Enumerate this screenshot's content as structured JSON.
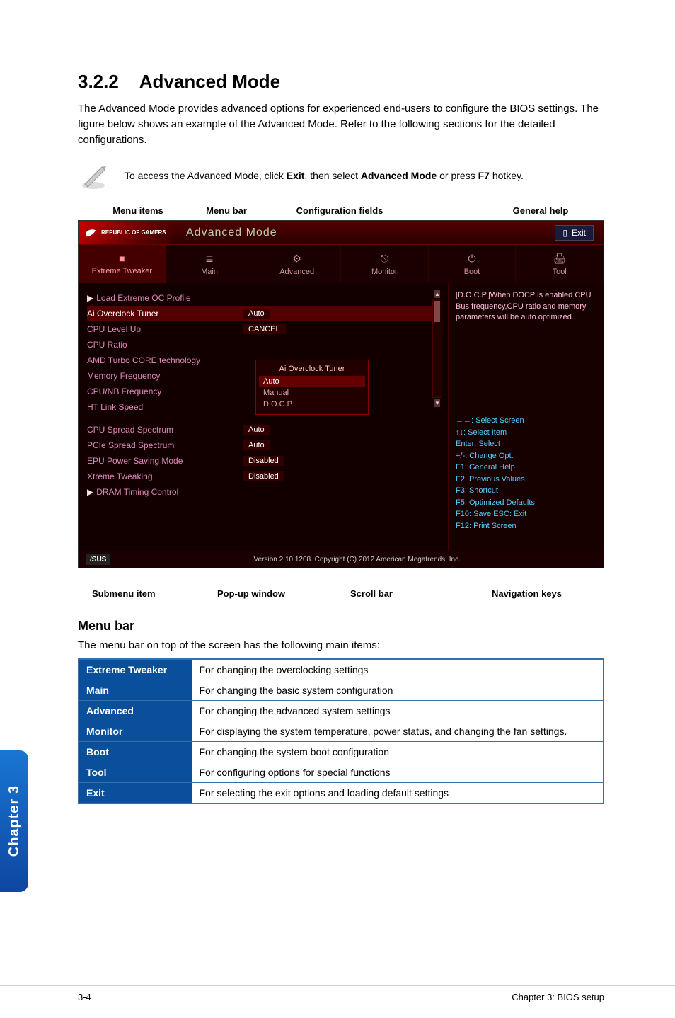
{
  "section": {
    "number": "3.2.2",
    "title": "Advanced Mode"
  },
  "intro": "The Advanced Mode provides advanced options for experienced end-users to configure the BIOS settings. The figure below shows an example of the Advanced Mode. Refer to the following sections for the detailed configurations.",
  "note": "To access the Advanced Mode, click Exit, then select Advanced Mode or press F7 hotkey.",
  "annot_top": {
    "menu_items": "Menu items",
    "menu_bar": "Menu bar",
    "config_fields": "Configuration fields",
    "general_help": "General help"
  },
  "bios": {
    "rog": "REPUBLIC OF GAMERS",
    "mode": "Advanced Mode",
    "exit": "Exit",
    "tabs": [
      {
        "icon": "■",
        "label": "Extreme Tweaker",
        "active": true
      },
      {
        "icon": "≣",
        "label": "Main"
      },
      {
        "icon": "⚙",
        "label": "Advanced"
      },
      {
        "icon": "⎋",
        "label": "Monitor"
      },
      {
        "icon": "⏻",
        "label": "Boot"
      },
      {
        "icon": "🖨",
        "label": "Tool"
      }
    ],
    "fields": [
      {
        "type": "sub",
        "label": "Load Extreme OC Profile"
      },
      {
        "type": "hi",
        "label": "Ai Overclock Tuner",
        "val": "Auto"
      },
      {
        "type": "row",
        "label": "CPU Level Up",
        "val": "CANCEL"
      },
      {
        "type": "row",
        "label": "CPU Ratio",
        "val": ""
      },
      {
        "type": "row",
        "label": "AMD Turbo CORE technology"
      },
      {
        "type": "row",
        "label": "Memory Frequency"
      },
      {
        "type": "row",
        "label": "CPU/NB Frequency"
      },
      {
        "type": "row",
        "label": "HT Link Speed"
      },
      {
        "type": "gap"
      },
      {
        "type": "row",
        "label": "CPU Spread Spectrum",
        "val": "Auto"
      },
      {
        "type": "row",
        "label": "PCIe Spread Spectrum",
        "val": "Auto"
      },
      {
        "type": "row",
        "label": "EPU Power Saving Mode",
        "val": "Disabled"
      },
      {
        "type": "row",
        "label": "Xtreme Tweaking",
        "val": "Disabled"
      },
      {
        "type": "sub",
        "label": "DRAM Timing Control"
      }
    ],
    "popup": {
      "title": "Ai Overclock Tuner",
      "items": [
        "Auto",
        "Manual",
        "D.O.C.P."
      ],
      "selected": 0
    },
    "help_top": "[D.O.C.P.]When DOCP is enabled CPU Bus frequency,CPU ratio and memory parameters will be auto optimized.",
    "help_keys": [
      "→←: Select Screen",
      "↑↓: Select Item",
      "Enter: Select",
      "+/-: Change Opt.",
      "F1: General Help",
      "F2: Previous Values",
      "F3: Shortcut",
      "F5: Optimized Defaults",
      "F10: Save  ESC: Exit",
      "F12: Print Screen"
    ],
    "footer_brand": "/SUS",
    "footer_ver": "Version 2.10.1208. Copyright (C) 2012 American Megatrends, Inc."
  },
  "annot_bottom": {
    "submenu": "Submenu item",
    "popup": "Pop-up window",
    "scroll": "Scroll bar",
    "nav": "Navigation keys"
  },
  "menubar_h": "Menu bar",
  "menubar_intro": "The menu bar on top of the screen has the following main items:",
  "menutable": [
    {
      "k": "Extreme Tweaker",
      "v": "For changing the overclocking settings"
    },
    {
      "k": "Main",
      "v": "For changing the basic system configuration"
    },
    {
      "k": "Advanced",
      "v": "For changing the advanced system settings"
    },
    {
      "k": "Monitor",
      "v": "For displaying the system temperature, power status, and changing the fan settings."
    },
    {
      "k": "Boot",
      "v": "For changing the system boot configuration"
    },
    {
      "k": "Tool",
      "v": "For configuring options for special functions"
    },
    {
      "k": "Exit",
      "v": "For selecting the exit options and loading default settings"
    }
  ],
  "page_footer": {
    "left": "3-4",
    "right": "Chapter 3: BIOS setup"
  },
  "side_tab": "Chapter 3"
}
